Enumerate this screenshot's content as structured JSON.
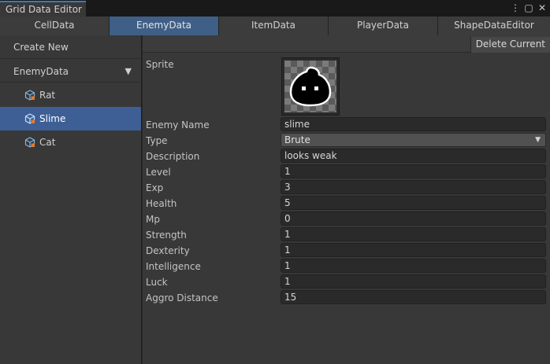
{
  "window": {
    "title": "Grid Data Editor",
    "controls": {
      "menu_glyph": "⋮",
      "maximize_glyph": "▢",
      "close_glyph": "✕"
    }
  },
  "tabs": [
    {
      "label": "CellData",
      "active": false
    },
    {
      "label": "EnemyData",
      "active": true
    },
    {
      "label": "ItemData",
      "active": false
    },
    {
      "label": "PlayerData",
      "active": false
    },
    {
      "label": "ShapeDataEditor",
      "active": false
    }
  ],
  "sidebar": {
    "create_new_label": "Create New",
    "group_label": "EnemyData",
    "group_arrow": "▼",
    "items": [
      {
        "label": "Rat",
        "icon": "scriptable-object-icon",
        "selected": false
      },
      {
        "label": "Slime",
        "icon": "scriptable-object-icon",
        "selected": true
      },
      {
        "label": "Cat",
        "icon": "scriptable-object-icon",
        "selected": false
      }
    ]
  },
  "toolbar": {
    "delete_label": "Delete Current"
  },
  "inspector": {
    "sprite_label": "Sprite",
    "sprite_icon": "slime-sprite-icon",
    "fields": [
      {
        "label": "Enemy Name",
        "value": "slime",
        "kind": "text"
      },
      {
        "label": "Type",
        "value": "Brute",
        "kind": "dropdown"
      },
      {
        "label": "Description",
        "value": "looks weak",
        "kind": "text"
      },
      {
        "label": "Level",
        "value": "1",
        "kind": "number"
      },
      {
        "label": "Exp",
        "value": "3",
        "kind": "number"
      },
      {
        "label": "Health",
        "value": "5",
        "kind": "number"
      },
      {
        "label": "Mp",
        "value": "0",
        "kind": "number"
      },
      {
        "label": "Strength",
        "value": "1",
        "kind": "number"
      },
      {
        "label": "Dexterity",
        "value": "1",
        "kind": "number"
      },
      {
        "label": "Intelligence",
        "value": "1",
        "kind": "number"
      },
      {
        "label": "Luck",
        "value": "1",
        "kind": "number"
      },
      {
        "label": "Aggro Distance",
        "value": "15",
        "kind": "number"
      }
    ],
    "dropdown_arrow": "▼"
  },
  "colors": {
    "accent": "#3a79bb",
    "selection": "#3e5f96",
    "active_tab": "#3f5f86"
  }
}
